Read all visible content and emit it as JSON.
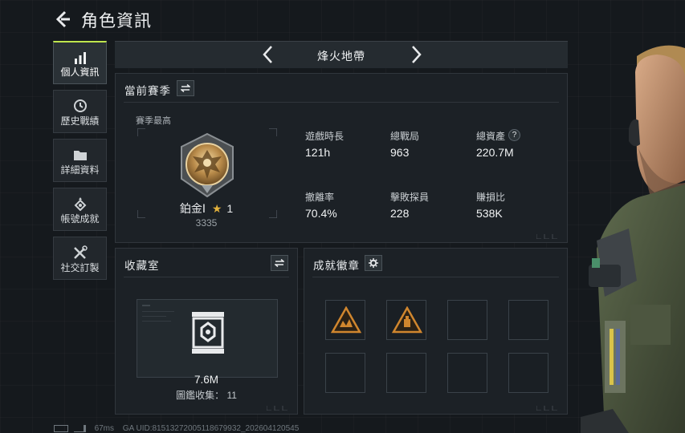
{
  "header": {
    "title": "角色資訊"
  },
  "sidebar": {
    "items": [
      {
        "label": "個人資訊",
        "icon": "bar-chart-icon",
        "active": true
      },
      {
        "label": "歷史戰績",
        "icon": "history-clock-icon",
        "active": false
      },
      {
        "label": "詳細資料",
        "icon": "folder-icon",
        "active": false
      },
      {
        "label": "帳號成就",
        "icon": "medal-icon",
        "active": false
      },
      {
        "label": "社交訂製",
        "icon": "tools-icon",
        "active": false
      }
    ]
  },
  "map_selector": {
    "current": "烽火地帶"
  },
  "season": {
    "title": "當前賽季",
    "best_label": "賽季最高",
    "rank_name": "鉑金Ⅰ",
    "rank_stars": "1",
    "rank_score": "3335",
    "stats": [
      {
        "label": "遊戲時長",
        "value": "121h"
      },
      {
        "label": "總戰局",
        "value": "963"
      },
      {
        "label": "總資產",
        "value": "220.7M",
        "help": "?"
      },
      {
        "label": "撤離率",
        "value": "70.4%"
      },
      {
        "label": "擊敗探員",
        "value": "228"
      },
      {
        "label": "賺損比",
        "value": "538K"
      }
    ]
  },
  "collection": {
    "title": "收藏室",
    "value": "7.6M",
    "count_label": "圖鑑收集：",
    "count_value": "11"
  },
  "achievements": {
    "title": "成就徽章",
    "slots": [
      "filled",
      "filled",
      "empty",
      "empty",
      "empty",
      "empty",
      "empty",
      "empty"
    ]
  },
  "footer": {
    "ping": "67ms",
    "uid": "GA UID:815132720051186799​32_202604120545"
  },
  "colors": {
    "accent": "#bfe64d",
    "background": "#15191d",
    "panel": "#1c2126",
    "badge_orange": "#d0862e"
  }
}
